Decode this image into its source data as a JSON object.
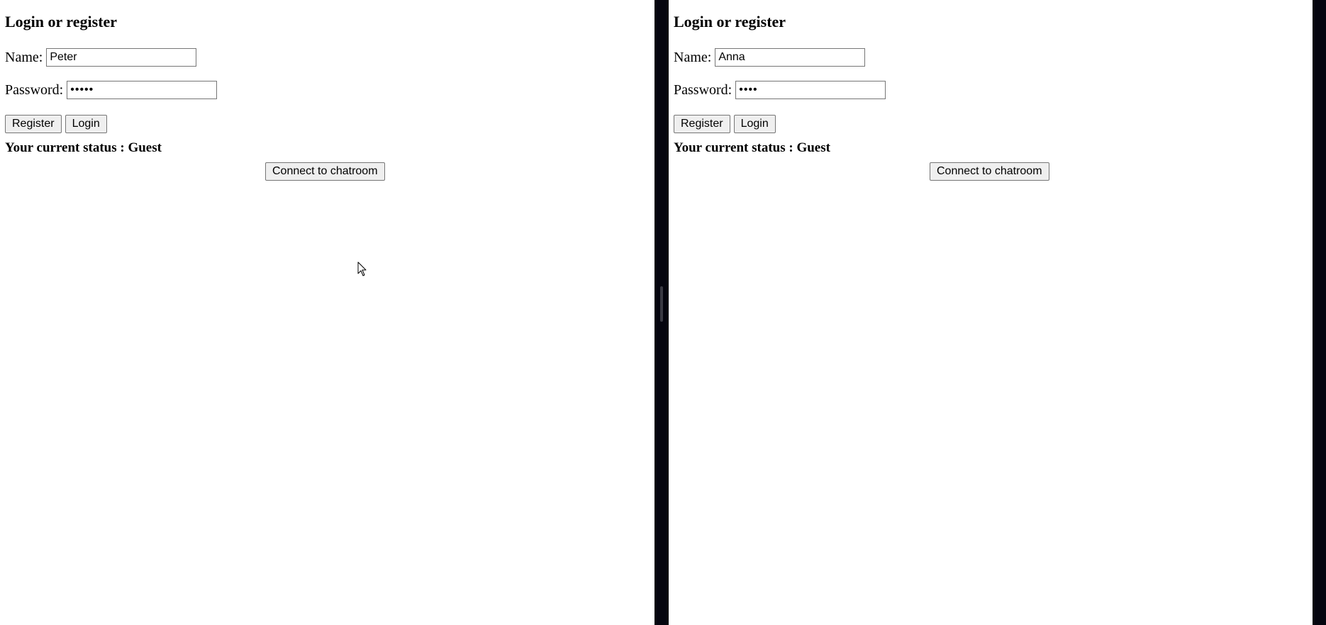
{
  "left_pane": {
    "heading": "Login or register",
    "name_label": "Name:",
    "name_value": "Peter",
    "password_label": "Password:",
    "password_value": "•••••",
    "register_label": "Register",
    "login_label": "Login",
    "status_text": "Your current status : Guest",
    "connect_label": "Connect to chatroom"
  },
  "right_pane": {
    "heading": "Login or register",
    "name_label": "Name:",
    "name_value": "Anna",
    "password_label": "Password:",
    "password_value": "••••",
    "register_label": "Register",
    "login_label": "Login",
    "status_text": "Your current status : Guest",
    "connect_label": "Connect to chatroom"
  },
  "colors": {
    "page_background": "#ffffff",
    "divider": "#05050f",
    "button_background": "#efefef",
    "border": "#767676"
  },
  "icons": {
    "cursor": "mouse-pointer-icon"
  }
}
